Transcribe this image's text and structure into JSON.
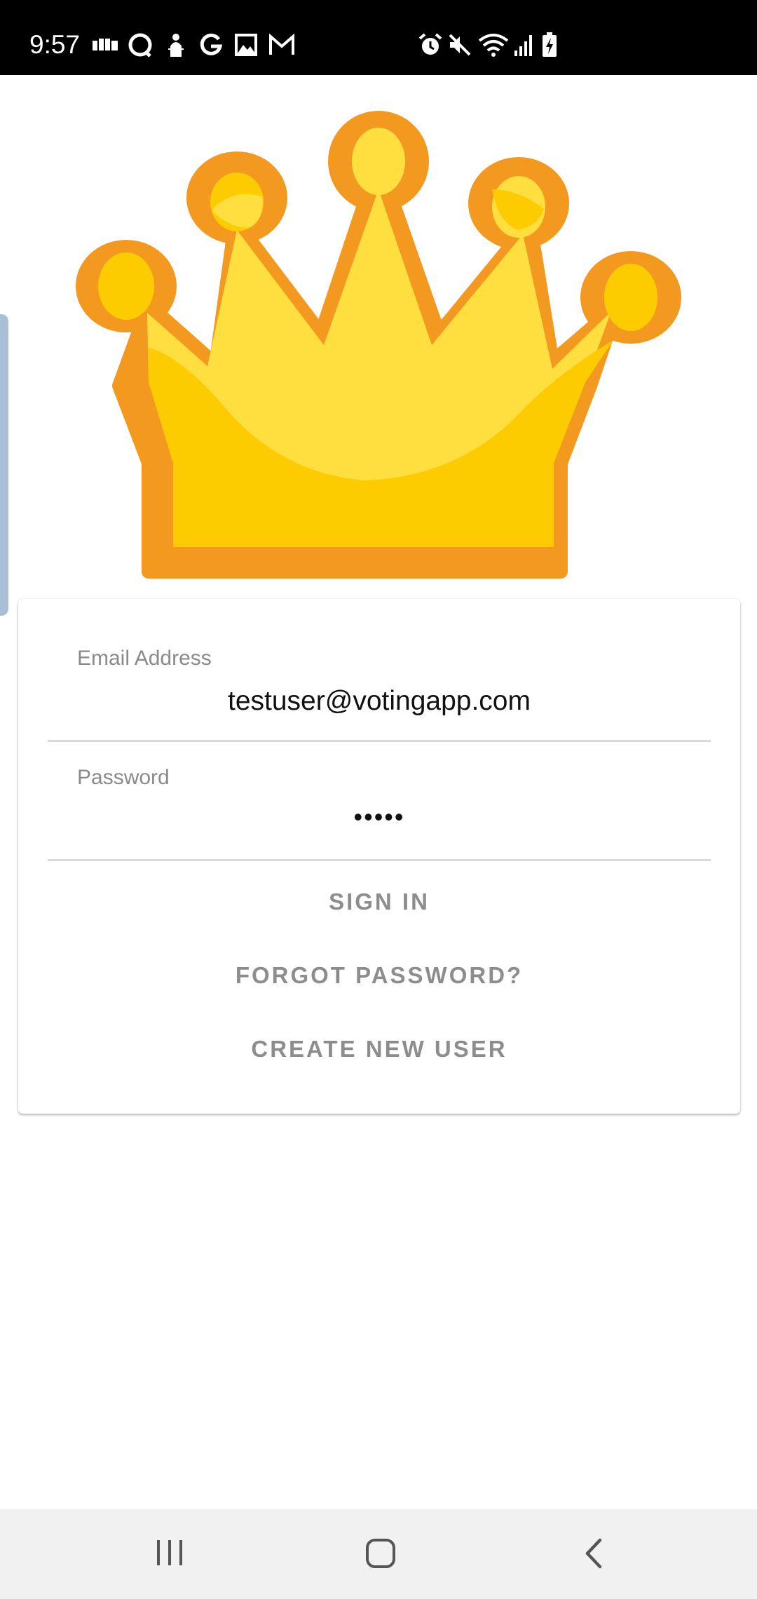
{
  "status_bar": {
    "time": "9:57",
    "left_icons": [
      "app-icon",
      "chat-bubble-icon",
      "figure-icon",
      "google-icon",
      "gallery-icon",
      "gmail-icon"
    ],
    "right_icons": [
      "alarm-icon",
      "mute-icon",
      "wifi-icon",
      "signal-icon",
      "battery-charging-icon"
    ]
  },
  "logo": {
    "icon": "crown-icon",
    "colors": {
      "outline": "#F4991F",
      "light": "#FFDF40",
      "dark": "#FCCC00"
    }
  },
  "login": {
    "email": {
      "label": "Email Address",
      "value": "testuser@votingapp.com"
    },
    "password": {
      "label": "Password",
      "value": "•••••"
    },
    "sign_in_label": "SIGN IN",
    "forgot_password_label": "FORGOT PASSWORD?",
    "create_user_label": "CREATE NEW USER"
  },
  "nav_bar": {
    "icons": [
      "recent-apps-icon",
      "home-icon",
      "back-icon"
    ]
  }
}
